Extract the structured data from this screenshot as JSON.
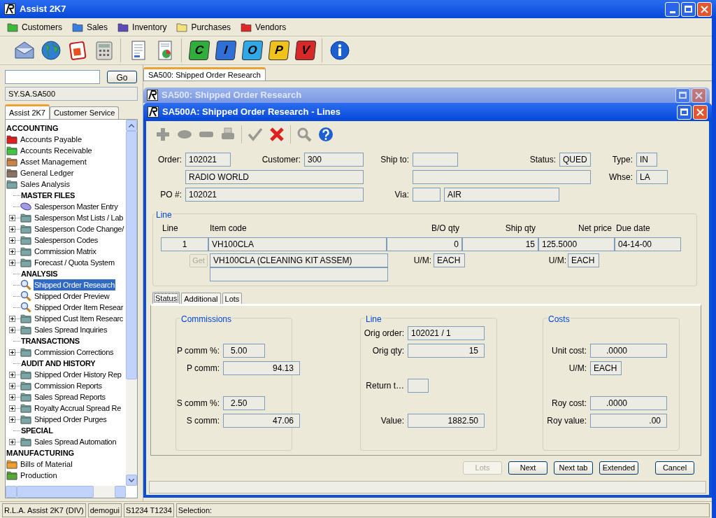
{
  "app": {
    "title": "Assist 2K7"
  },
  "menu": [
    {
      "label": "Customers",
      "color": "#3cb83c"
    },
    {
      "label": "Sales",
      "color": "#3a7fe0"
    },
    {
      "label": "Inventory",
      "color": "#5b4cb8"
    },
    {
      "label": "Purchases",
      "color": "#f2e27a"
    },
    {
      "label": "Vendors",
      "color": "#e02828"
    }
  ],
  "toolbar": {
    "groups": [
      [
        {
          "kind": "mail"
        },
        {
          "kind": "globe"
        },
        {
          "kind": "calendar"
        },
        {
          "kind": "calculator"
        }
      ],
      [
        {
          "kind": "document"
        },
        {
          "kind": "report"
        }
      ],
      [
        {
          "kind": "letter",
          "letter": "C",
          "color": "#2fae3a"
        },
        {
          "kind": "letter",
          "letter": "I",
          "color": "#2f6fd8"
        },
        {
          "kind": "letter",
          "letter": "O",
          "color": "#2fa8e8"
        },
        {
          "kind": "letter",
          "letter": "P",
          "color": "#f2c21c"
        },
        {
          "kind": "letter",
          "letter": "V",
          "color": "#d82828"
        }
      ],
      [
        {
          "kind": "info"
        }
      ]
    ]
  },
  "sidebar": {
    "search": {
      "button": "Go"
    },
    "path": "SY.SA.SA500",
    "tabs": [
      {
        "label": "Assist 2K7",
        "selected": true
      },
      {
        "label": "Customer Service",
        "selected": false
      }
    ],
    "tree": [
      {
        "label": "ACCOUNTING",
        "kind": "category",
        "children": [
          {
            "label": "Accounts Payable",
            "kind": "folder",
            "color": "#e02020"
          },
          {
            "label": "Accounts Receivable",
            "kind": "folder",
            "color": "#44c444"
          },
          {
            "label": "Asset Management",
            "kind": "folder",
            "color": "#c8844a"
          },
          {
            "label": "General Ledger",
            "kind": "folder",
            "color": "#8c7464"
          },
          {
            "label": "Sales Analysis",
            "kind": "folder",
            "color": "#7aa6a6",
            "children": [
              {
                "label": "MASTER FILES",
                "kind": "section",
                "selected": false
              },
              {
                "label": "Salesperson Master Entry",
                "kind": "entry",
                "selected": false
              },
              {
                "label": "Salesperson Mst Lists / Lab",
                "kind": "folder",
                "collapsed": true,
                "selected": false
              },
              {
                "label": "Salesperson Code Change/",
                "kind": "folder",
                "collapsed": true,
                "selected": false
              },
              {
                "label": "Salesperson Codes",
                "kind": "folder",
                "collapsed": true,
                "selected": false
              },
              {
                "label": "Commission Matrix",
                "kind": "folder",
                "collapsed": true,
                "selected": false
              },
              {
                "label": "Forecast / Quota System",
                "kind": "folder",
                "collapsed": true,
                "selected": false
              },
              {
                "label": "ANALYSIS",
                "kind": "section",
                "selected": false
              },
              {
                "label": "Shipped Order Research",
                "kind": "search",
                "selected": true
              },
              {
                "label": "Shipped Order Preview",
                "kind": "search",
                "selected": false
              },
              {
                "label": "Shipped Order Item Resear",
                "kind": "search",
                "selected": false
              },
              {
                "label": "Shipped Cust Item Researc",
                "kind": "folder",
                "collapsed": true,
                "selected": false
              },
              {
                "label": "Sales Spread Inquiries",
                "kind": "folder",
                "collapsed": true,
                "selected": false
              },
              {
                "label": "TRANSACTIONS",
                "kind": "section",
                "selected": false
              },
              {
                "label": "Commission Corrections",
                "kind": "folder",
                "collapsed": true,
                "selected": false
              },
              {
                "label": "AUDIT AND HISTORY",
                "kind": "section",
                "selected": false
              },
              {
                "label": "Shipped Order History Rep",
                "kind": "folder",
                "collapsed": true,
                "selected": false
              },
              {
                "label": "Commission Reports",
                "kind": "folder",
                "collapsed": true,
                "selected": false
              },
              {
                "label": "Sales Spread Reports",
                "kind": "folder",
                "collapsed": true,
                "selected": false
              },
              {
                "label": "Royalty Accrual Spread Re",
                "kind": "folder",
                "collapsed": true,
                "selected": false
              },
              {
                "label": "Shipped Order Purges",
                "kind": "folder",
                "collapsed": true,
                "selected": false
              },
              {
                "label": "SPECIAL",
                "kind": "section",
                "selected": false
              },
              {
                "label": "Sales Spread Automation",
                "kind": "folder",
                "collapsed": true,
                "selected": false
              }
            ]
          }
        ]
      },
      {
        "label": "MANUFACTURING",
        "kind": "category",
        "children": [
          {
            "label": "Bills of Material",
            "kind": "folder",
            "color": "#f0a030"
          },
          {
            "label": "Production",
            "kind": "folder",
            "color": "#58a838"
          }
        ]
      }
    ]
  },
  "document_tabs": [
    {
      "label": "SA500: Shipped Order Research",
      "selected": true
    }
  ],
  "back_window": {
    "title": "SA500: Shipped Order Research"
  },
  "window": {
    "title": "SA500A: Shipped Order Research - Lines",
    "toolbar": [
      {
        "kind": "add",
        "disabled": true
      },
      {
        "kind": "oval",
        "disabled": true
      },
      {
        "kind": "remove",
        "disabled": true
      },
      {
        "kind": "print",
        "disabled": true
      },
      {
        "kind": "check",
        "disabled": true
      },
      {
        "kind": "cancel",
        "disabled": false
      },
      {
        "kind": "search",
        "disabled": true
      },
      {
        "kind": "help",
        "disabled": false
      }
    ],
    "header": {
      "order": {
        "label": "Order:",
        "value": "102021"
      },
      "customer": {
        "label": "Customer:",
        "value": "300"
      },
      "ship_to": {
        "label": "Ship to:"
      },
      "status": {
        "label": "Status:",
        "value": "QUED"
      },
      "type": {
        "label": "Type:",
        "value": "IN"
      },
      "customer_name": "RADIO WORLD",
      "whse": {
        "label": "Whse:",
        "value": "LA"
      },
      "po": {
        "label": "PO #:",
        "value": "102021"
      },
      "via": {
        "label": "Via:"
      },
      "via_name": "AIR"
    },
    "line": {
      "title": "Line",
      "columns": [
        "Line",
        "Item code",
        "B/O qty",
        "Ship qty",
        "Net price",
        "Due date"
      ],
      "values": [
        "1",
        "VH100CLA",
        "0",
        "15",
        "125.5000",
        "04-14-00"
      ],
      "get_button": {
        "label": "Get",
        "disabled": true
      },
      "description": "VH100CLA (CLEANING KIT ASSEM)",
      "um_fields": [
        {
          "label": "U/M:",
          "value": "EACH"
        },
        {
          "label": "U/M:",
          "value": "EACH"
        }
      ]
    },
    "tabs": [
      {
        "label": "Status",
        "selected": true
      },
      {
        "label": "Additional",
        "selected": false
      },
      {
        "label": "Lots",
        "selected": false
      }
    ],
    "groups": [
      {
        "title": "Commissions",
        "fields": [
          {
            "label": "P comm %:",
            "value": "5.00"
          },
          {
            "label": "P comm:",
            "value": "94.13"
          },
          {
            "label": "S comm %:",
            "value": "2.50"
          },
          {
            "label": "S comm:",
            "value": "47.06"
          }
        ]
      },
      {
        "title": "Line",
        "fields": [
          {
            "label": "Orig order:",
            "value": "102021 / 1"
          },
          {
            "label": "Orig qty:",
            "value": "15"
          },
          {
            "label": "Return t…"
          },
          {
            "label": "Value:",
            "value": "1882.50"
          }
        ]
      },
      {
        "title": "Costs",
        "fields": [
          {
            "label": "Unit cost:",
            "value": ".0000"
          },
          {
            "label": "U/M:",
            "value": "EACH"
          },
          {
            "label": "Roy cost:",
            "value": ".0000"
          },
          {
            "label": "Roy value:",
            "value": ".00"
          }
        ]
      }
    ],
    "buttons": [
      {
        "label": "Lots",
        "disabled": true
      },
      {
        "label": "Next",
        "disabled": false
      },
      {
        "label": "Next tab",
        "disabled": false
      },
      {
        "label": "Extended",
        "disabled": false
      },
      {
        "label": "Cancel",
        "disabled": false
      }
    ]
  },
  "status_bar": [
    "R.L.A. Assist 2K7 (DIV)",
    "demogui",
    "S1234 T1234",
    "Selection:"
  ]
}
